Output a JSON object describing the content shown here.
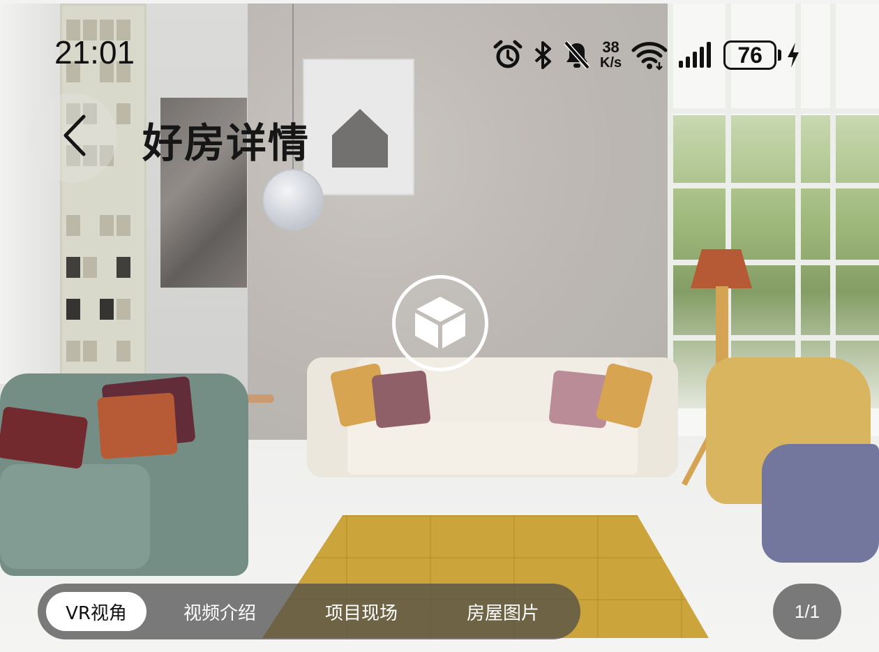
{
  "status_bar": {
    "time": "21:01",
    "net_speed_value": "38",
    "net_speed_unit": "K/s",
    "battery_level": "76",
    "icons": [
      "alarm-icon",
      "bluetooth-icon",
      "bell-muted-icon",
      "wifi-icon",
      "signal-icon",
      "battery-icon",
      "charging-icon"
    ]
  },
  "header": {
    "back_icon": "chevron-left-icon",
    "title": "好房详情"
  },
  "media": {
    "vr_icon": "cube-3d-icon",
    "tabs": [
      {
        "label": "VR视角",
        "active": true
      },
      {
        "label": "视频介绍",
        "active": false
      },
      {
        "label": "项目现场",
        "active": false
      },
      {
        "label": "房屋图片",
        "active": false
      }
    ],
    "page_counter": "1/1"
  }
}
